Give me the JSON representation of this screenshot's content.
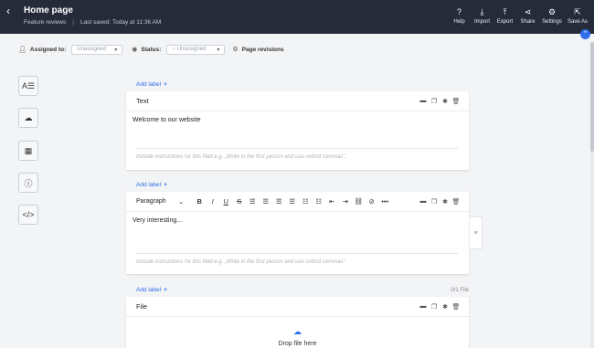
{
  "header": {
    "back_icon": "chevron-left-icon",
    "title": "Home page",
    "subtitle": "Feature reviews",
    "saved": "Last saved: Today at 11:36 AM",
    "tools": [
      {
        "label": "Help",
        "icon": "help-icon",
        "glyph": "?"
      },
      {
        "label": "Import",
        "icon": "import-icon",
        "glyph": "⤓"
      },
      {
        "label": "Export",
        "icon": "export-icon",
        "glyph": "⤒"
      },
      {
        "label": "Share",
        "icon": "share-icon",
        "glyph": "⋖"
      },
      {
        "label": "Settings",
        "icon": "gear-icon",
        "glyph": "⚙"
      },
      {
        "label": "Save As",
        "icon": "save-as-icon",
        "glyph": "⇱"
      }
    ]
  },
  "meta": {
    "assigned_label": "Assigned to:",
    "assigned_value": "Unassigned",
    "status_label": "Status:",
    "status_value": "Unassigned",
    "revisions_label": "Page revisions"
  },
  "sidebar_tools": [
    "text-format-icon",
    "cloud-upload-icon",
    "table-icon",
    "info-icon",
    "code-icon"
  ],
  "fields": {
    "add_label": "Add label",
    "text": {
      "title": "Text",
      "value": "Welcome to our website",
      "instructions": "Include instructions for this field e.g. „Write in the first person and use oxford commas\"."
    },
    "richtext": {
      "paragraph": "Paragraph",
      "value": "Very interesting...",
      "instructions": "Include instructions for this field e.g. „Write in the first person and use oxford commas\"."
    },
    "file": {
      "count": "0/1 File",
      "title": "File",
      "drop": "Drop file here"
    }
  },
  "colors": {
    "topbar": "#262b3a",
    "accent": "#2f6fea",
    "background": "#f3f4f6"
  }
}
